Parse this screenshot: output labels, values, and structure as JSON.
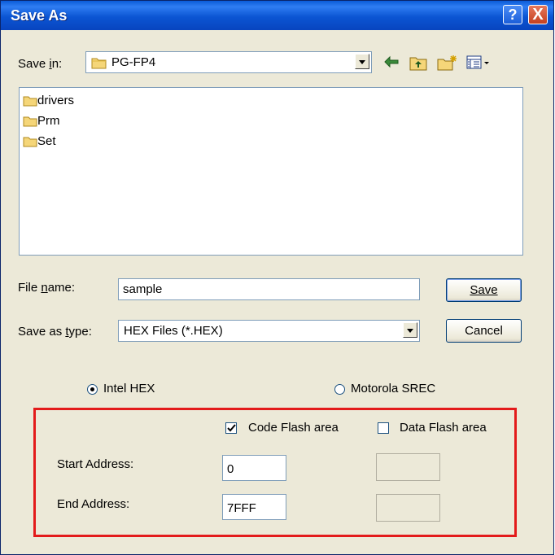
{
  "window": {
    "title": "Save As"
  },
  "titlebar": {
    "help_glyph": "?",
    "close_glyph": "X",
    "help_icon": "help-icon",
    "close_icon": "close-icon"
  },
  "save_in": {
    "label": "Save in:",
    "value": "PG-FP4"
  },
  "toolbar": {
    "icons": [
      "back-arrow-icon",
      "up-folder-icon",
      "new-folder-icon",
      "view-menu-icon"
    ]
  },
  "files": [
    {
      "name": "drivers",
      "icon": "folder-icon"
    },
    {
      "name": "Prm",
      "icon": "folder-icon"
    },
    {
      "name": "Set",
      "icon": "folder-icon"
    }
  ],
  "file_name": {
    "label": "File name:",
    "value": "sample"
  },
  "save_type": {
    "label": "Save as type:",
    "value": "HEX Files (*.HEX)"
  },
  "buttons": {
    "save": "Save",
    "cancel": "Cancel"
  },
  "format": {
    "intel": "Intel HEX",
    "motorola": "Motorola SREC",
    "selected": "Intel HEX"
  },
  "areas": {
    "code_flash": {
      "label": "Code Flash area",
      "checked": true
    },
    "data_flash": {
      "label": "Data Flash area",
      "checked": false
    }
  },
  "address": {
    "start_label": "Start Address:",
    "end_label": "End Address:",
    "code_start": "0",
    "code_end": "7FFF",
    "data_start": "",
    "data_end": ""
  },
  "colors": {
    "titlebar": "#0a5bd8",
    "dialog_bg": "#ece9d8",
    "highlight_box": "#e31b1b"
  }
}
